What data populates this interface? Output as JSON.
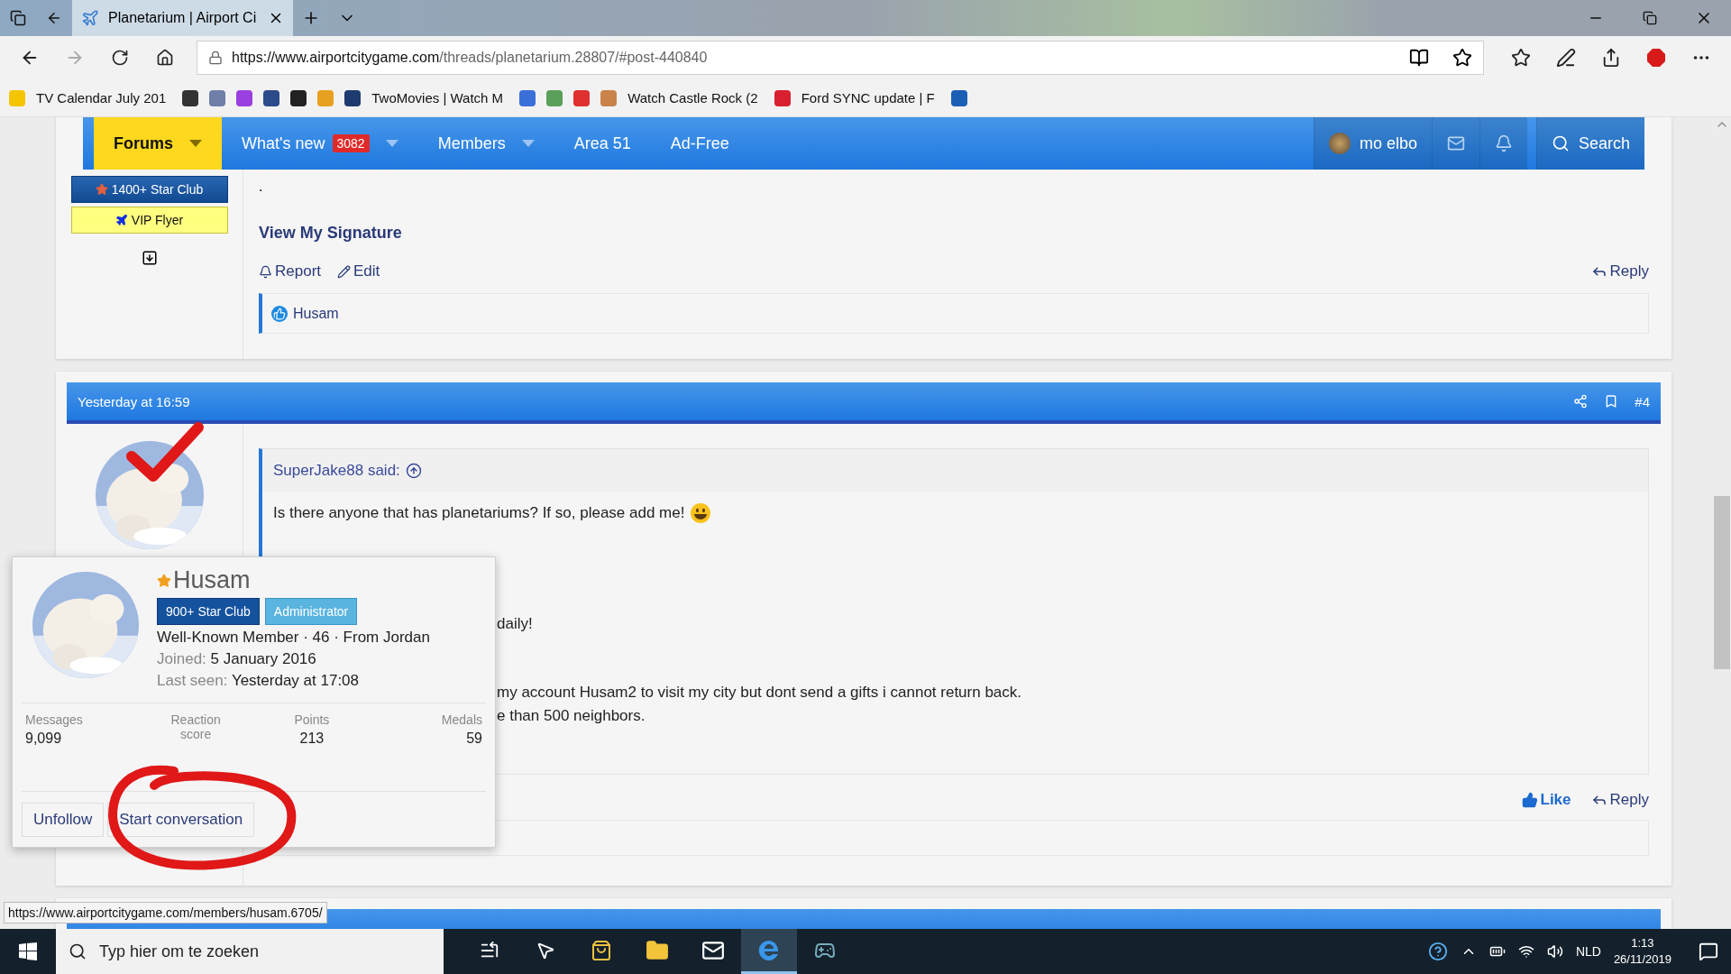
{
  "browser": {
    "tabs": [
      {
        "title": "Planetarium | Airport Ci",
        "selected": true
      }
    ],
    "url": {
      "host": "https://www.airportcitygame.com",
      "path": "/threads/planetarium.28807/#post-440840"
    },
    "favorites": [
      {
        "kind": "icon",
        "color": "#f5c400"
      },
      {
        "kind": "link",
        "label": "TV Calendar July 201"
      },
      {
        "kind": "icon",
        "color": "#333333"
      },
      {
        "kind": "icon",
        "color": "#6f7fa8"
      },
      {
        "kind": "icon",
        "color": "#9a3fe0"
      },
      {
        "kind": "icon",
        "color": "#2d4a8a"
      },
      {
        "kind": "icon",
        "color": "#222222"
      },
      {
        "kind": "icon",
        "color": "#e8a020"
      },
      {
        "kind": "icon",
        "color": "#1d3b6e"
      },
      {
        "kind": "link",
        "label": "TwoMovies | Watch M"
      },
      {
        "kind": "icon",
        "color": "#3a6fd8"
      },
      {
        "kind": "icon",
        "color": "#5aa05a"
      },
      {
        "kind": "icon",
        "color": "#e03030"
      },
      {
        "kind": "icon",
        "color": "#c9824a"
      },
      {
        "kind": "link",
        "label": "Watch Castle Rock (2"
      },
      {
        "kind": "icon",
        "color": "#d82030"
      },
      {
        "kind": "link",
        "label": "Ford SYNC update | F"
      },
      {
        "kind": "icon",
        "color": "#1a5fb4"
      }
    ]
  },
  "nav": {
    "items": [
      {
        "label": "Forums",
        "selected": true,
        "dropdown": true
      },
      {
        "label": "What's new",
        "badge": "3082",
        "selected": false,
        "dropdown": true
      },
      {
        "label": "Members",
        "selected": false,
        "dropdown": true
      },
      {
        "label": "Area 51",
        "selected": false,
        "dropdown": false
      },
      {
        "label": "Ad-Free",
        "selected": false,
        "dropdown": false
      }
    ],
    "user": "mo elbo",
    "search": "Search"
  },
  "post1": {
    "badges": [
      {
        "label": "1400+ Star Club",
        "kind": "club"
      },
      {
        "label": "VIP Flyer",
        "kind": "vip"
      }
    ],
    "dot": ".",
    "signature_link": "View My Signature",
    "actions": [
      "Report",
      "Edit"
    ],
    "reply": "Reply",
    "reactions": "Husam"
  },
  "post2": {
    "date": "Yesterday at 16:59",
    "number": "#4",
    "quote_author": "SuperJake88 said:",
    "lines": [
      {
        "kind": "full",
        "text": "Is there anyone that has planetariums? If so, please add me!"
      },
      {
        "kind": "clipped",
        "text": "daily!"
      },
      {
        "kind": "clipped",
        "text": "my account Husam2 to visit my city but dont send a gifts i cannot return back."
      },
      {
        "kind": "clipped",
        "text": "e than 500 neighbors."
      }
    ],
    "like": "Like",
    "reply": "Reply"
  },
  "member_card": {
    "name": "Husam",
    "badges": [
      {
        "label": "900+ Star Club",
        "kind": "club"
      },
      {
        "label": "Administrator",
        "kind": "staff"
      }
    ],
    "title": "Well-Known Member · 46 · From Jordan",
    "joined_label": "Joined:",
    "joined": "5 January 2016",
    "last_seen_label": "Last seen:",
    "last_seen": "Yesterday at 17:08",
    "stats": [
      {
        "label": "Messages",
        "value": "9,099"
      },
      {
        "label": "Reaction score"
      },
      {
        "label": "Points",
        "value": "213"
      },
      {
        "label": "Medals",
        "value": "59"
      }
    ],
    "buttons": [
      "Unfollow",
      "Start conversation"
    ]
  },
  "status_url": "https://www.airportcitygame.com/members/husam.6705/",
  "taskbar": {
    "search_placeholder": "Typ hier om te zoeken",
    "apps": [
      {
        "kind": "task-view",
        "selected": false
      },
      {
        "kind": "cursor",
        "selected": false
      },
      {
        "kind": "store",
        "selected": false
      },
      {
        "kind": "folder",
        "selected": false
      },
      {
        "kind": "mail",
        "selected": false
      },
      {
        "kind": "edge",
        "selected": true
      },
      {
        "kind": "nox",
        "selected": false
      }
    ],
    "language": "NLD",
    "time": "1:13",
    "date": "26/11/2019"
  }
}
